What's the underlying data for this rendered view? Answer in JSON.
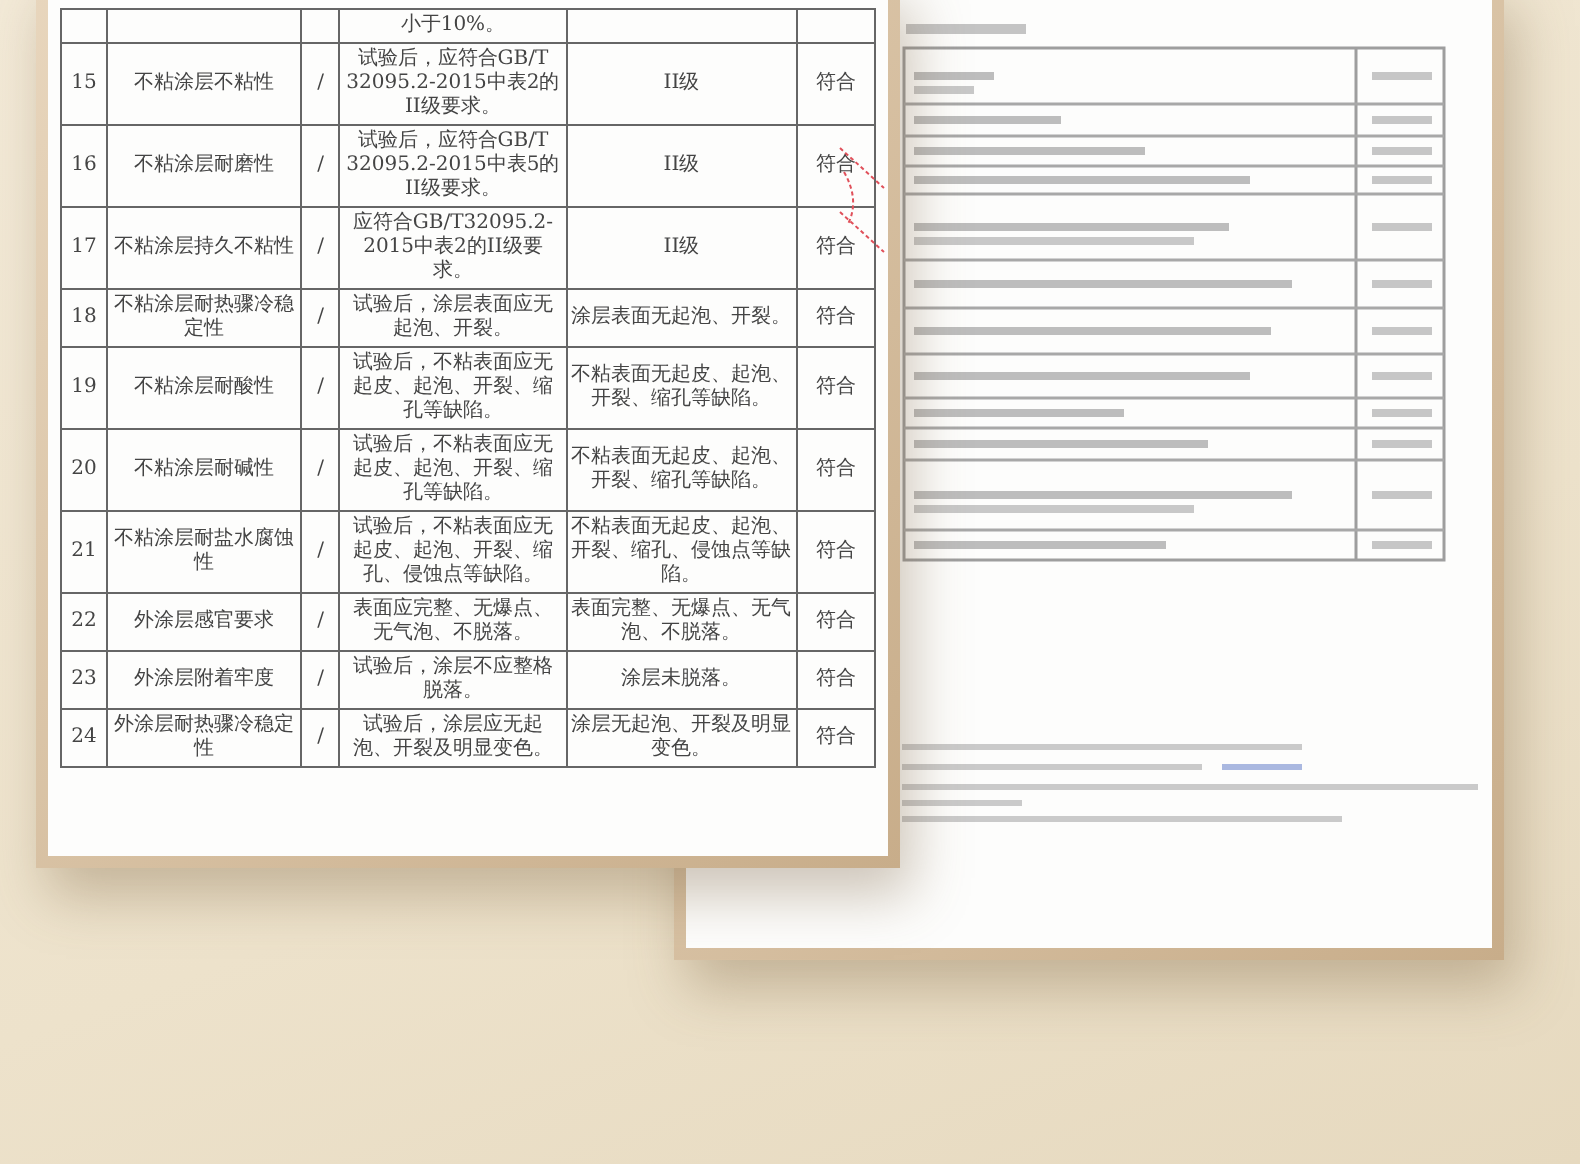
{
  "report_table": {
    "rows": [
      {
        "requirement": "小于10%。"
      },
      {
        "no": "15",
        "item": "不粘涂层不粘性",
        "unit": "/",
        "requirement": "试验后，应符合GB/T 32095.2-2015中表2的II级要求。",
        "result": "II级",
        "conclusion": "符合"
      },
      {
        "no": "16",
        "item": "不粘涂层耐磨性",
        "unit": "/",
        "requirement": "试验后，应符合GB/T 32095.2-2015中表5的II级要求。",
        "result": "II级",
        "conclusion": "符合"
      },
      {
        "no": "17",
        "item": "不粘涂层持久不粘性",
        "unit": "/",
        "requirement": "应符合GB/T32095.2-2015中表2的II级要求。",
        "result": "II级",
        "conclusion": "符合"
      },
      {
        "no": "18",
        "item": "不粘涂层耐热骤冷稳定性",
        "unit": "/",
        "requirement": "试验后，涂层表面应无起泡、开裂。",
        "result": "涂层表面无起泡、开裂。",
        "conclusion": "符合"
      },
      {
        "no": "19",
        "item": "不粘涂层耐酸性",
        "unit": "/",
        "requirement": "试验后，不粘表面应无起皮、起泡、开裂、缩孔等缺陷。",
        "result": "不粘表面无起皮、起泡、开裂、缩孔等缺陷。",
        "conclusion": "符合"
      },
      {
        "no": "20",
        "item": "不粘涂层耐碱性",
        "unit": "/",
        "requirement": "试验后，不粘表面应无起皮、起泡、开裂、缩孔等缺陷。",
        "result": "不粘表面无起皮、起泡、开裂、缩孔等缺陷。",
        "conclusion": "符合"
      },
      {
        "no": "21",
        "item": "不粘涂层耐盐水腐蚀性",
        "unit": "/",
        "requirement": "试验后，不粘表面应无起皮、起泡、开裂、缩孔、侵蚀点等缺陷。",
        "result": "不粘表面无起皮、起泡、开裂、缩孔、侵蚀点等缺陷。",
        "conclusion": "符合"
      },
      {
        "no": "22",
        "item": "外涂层感官要求",
        "unit": "/",
        "requirement": "表面应完整、无爆点、无气泡、不脱落。",
        "result": "表面完整、无爆点、无气泡、不脱落。",
        "conclusion": "符合"
      },
      {
        "no": "23",
        "item": "外涂层附着牢度",
        "unit": "/",
        "requirement": "试验后，涂层不应整格脱落。",
        "result": "涂层未脱落。",
        "conclusion": "符合"
      },
      {
        "no": "24",
        "item": "外涂层耐热骤冷稳定性",
        "unit": "/",
        "requirement": "试验后，涂层应无起泡、开裂及明显变色。",
        "result": "涂层无起泡、开裂及明显变色。",
        "conclusion": "符合"
      }
    ]
  }
}
